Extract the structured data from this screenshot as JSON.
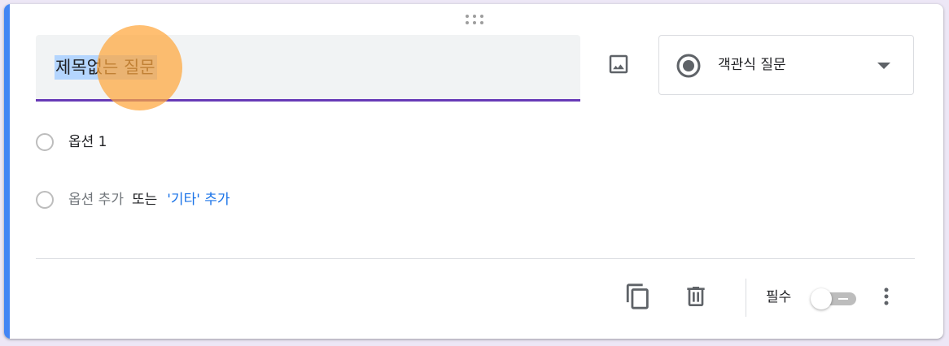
{
  "question": {
    "title": "제목없는 질문",
    "type_label": "객관식 질문"
  },
  "options": [
    {
      "label": "옵션 1"
    }
  ],
  "add_option": {
    "add_text": "옵션 추가",
    "or_text": "또는",
    "other_link": "'기타' 추가"
  },
  "footer": {
    "required_label": "필수",
    "required_on": false
  },
  "icons": {
    "drag": "drag-handle-icon",
    "image": "image-icon",
    "type": "radio-button-checked-icon",
    "caret": "arrow-drop-down-icon",
    "duplicate": "content-copy-icon",
    "delete": "trash-icon",
    "more": "more-vert-icon"
  },
  "colors": {
    "accent_bar": "#4285f4",
    "underline": "#673ab7",
    "link": "#1a73e8",
    "selection": "#b4d5fe",
    "cursor_highlight": "#ffa63c"
  }
}
